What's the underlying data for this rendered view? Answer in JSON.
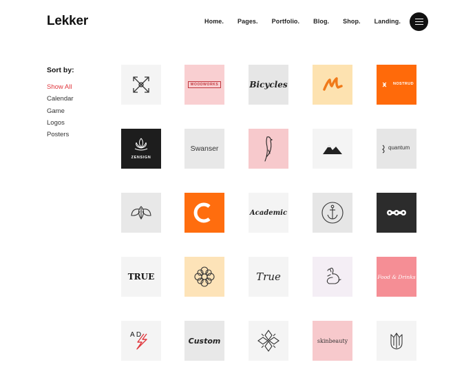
{
  "header": {
    "brand": "Lekker",
    "nav": [
      "Home.",
      "Pages.",
      "Portfolio.",
      "Blog.",
      "Shop.",
      "Landing."
    ]
  },
  "sidebar": {
    "title": "Sort by:",
    "filters": [
      "Show All",
      "Calendar",
      "Game",
      "Logos",
      "Posters"
    ]
  },
  "tiles": [
    {
      "icon": "crossed-arrows-icon",
      "bg": "#f4f4f4"
    },
    {
      "label": "WOODWORKS",
      "bg": "#f9cfd1"
    },
    {
      "label": "Bicycles",
      "bg": "#e6e6e6"
    },
    {
      "icon": "brush-stroke-icon",
      "bg": "#fde2b0"
    },
    {
      "label": "NOSTRUD",
      "bg": "#ff6a0a"
    },
    {
      "label": "ZENSIGN",
      "bg": "#1d1d1d"
    },
    {
      "label": "Swanser",
      "bg": "#e8e8e8"
    },
    {
      "icon": "bird-icon",
      "bg": "#f7c9cc"
    },
    {
      "icon": "mountains-icon",
      "bg": "#f4f4f4"
    },
    {
      "label": "quantum",
      "bg": "#e6e6e6"
    },
    {
      "icon": "leaves-icon",
      "bg": "#e8e8e8"
    },
    {
      "icon": "letter-c-icon",
      "bg": "#ff6d0e"
    },
    {
      "label": "Academic",
      "bg": "#f4f4f4"
    },
    {
      "icon": "anchor-icon",
      "bg": "#e6e6e6"
    },
    {
      "icon": "chain-links-icon",
      "bg": "#2c2c2c"
    },
    {
      "label": "TRUE",
      "bg": "#f4f4f4"
    },
    {
      "icon": "ornament-flower-icon",
      "bg": "#fde3b8"
    },
    {
      "label": "True",
      "bg": "#f4f4f4"
    },
    {
      "icon": "rabbit-icon",
      "bg": "#f4eef5"
    },
    {
      "label": "Food & Drinks",
      "bg": "#f58e95"
    },
    {
      "label": "A D",
      "bg": "#f4f4f4"
    },
    {
      "label": "Custom",
      "bg": "#e8e8e8"
    },
    {
      "icon": "snowflake-ornament-icon",
      "bg": "#f4f4f4"
    },
    {
      "label": "skinbeauty",
      "bg": "#f7c9cc"
    },
    {
      "icon": "tulip-icon",
      "bg": "#f4f4f4"
    }
  ]
}
